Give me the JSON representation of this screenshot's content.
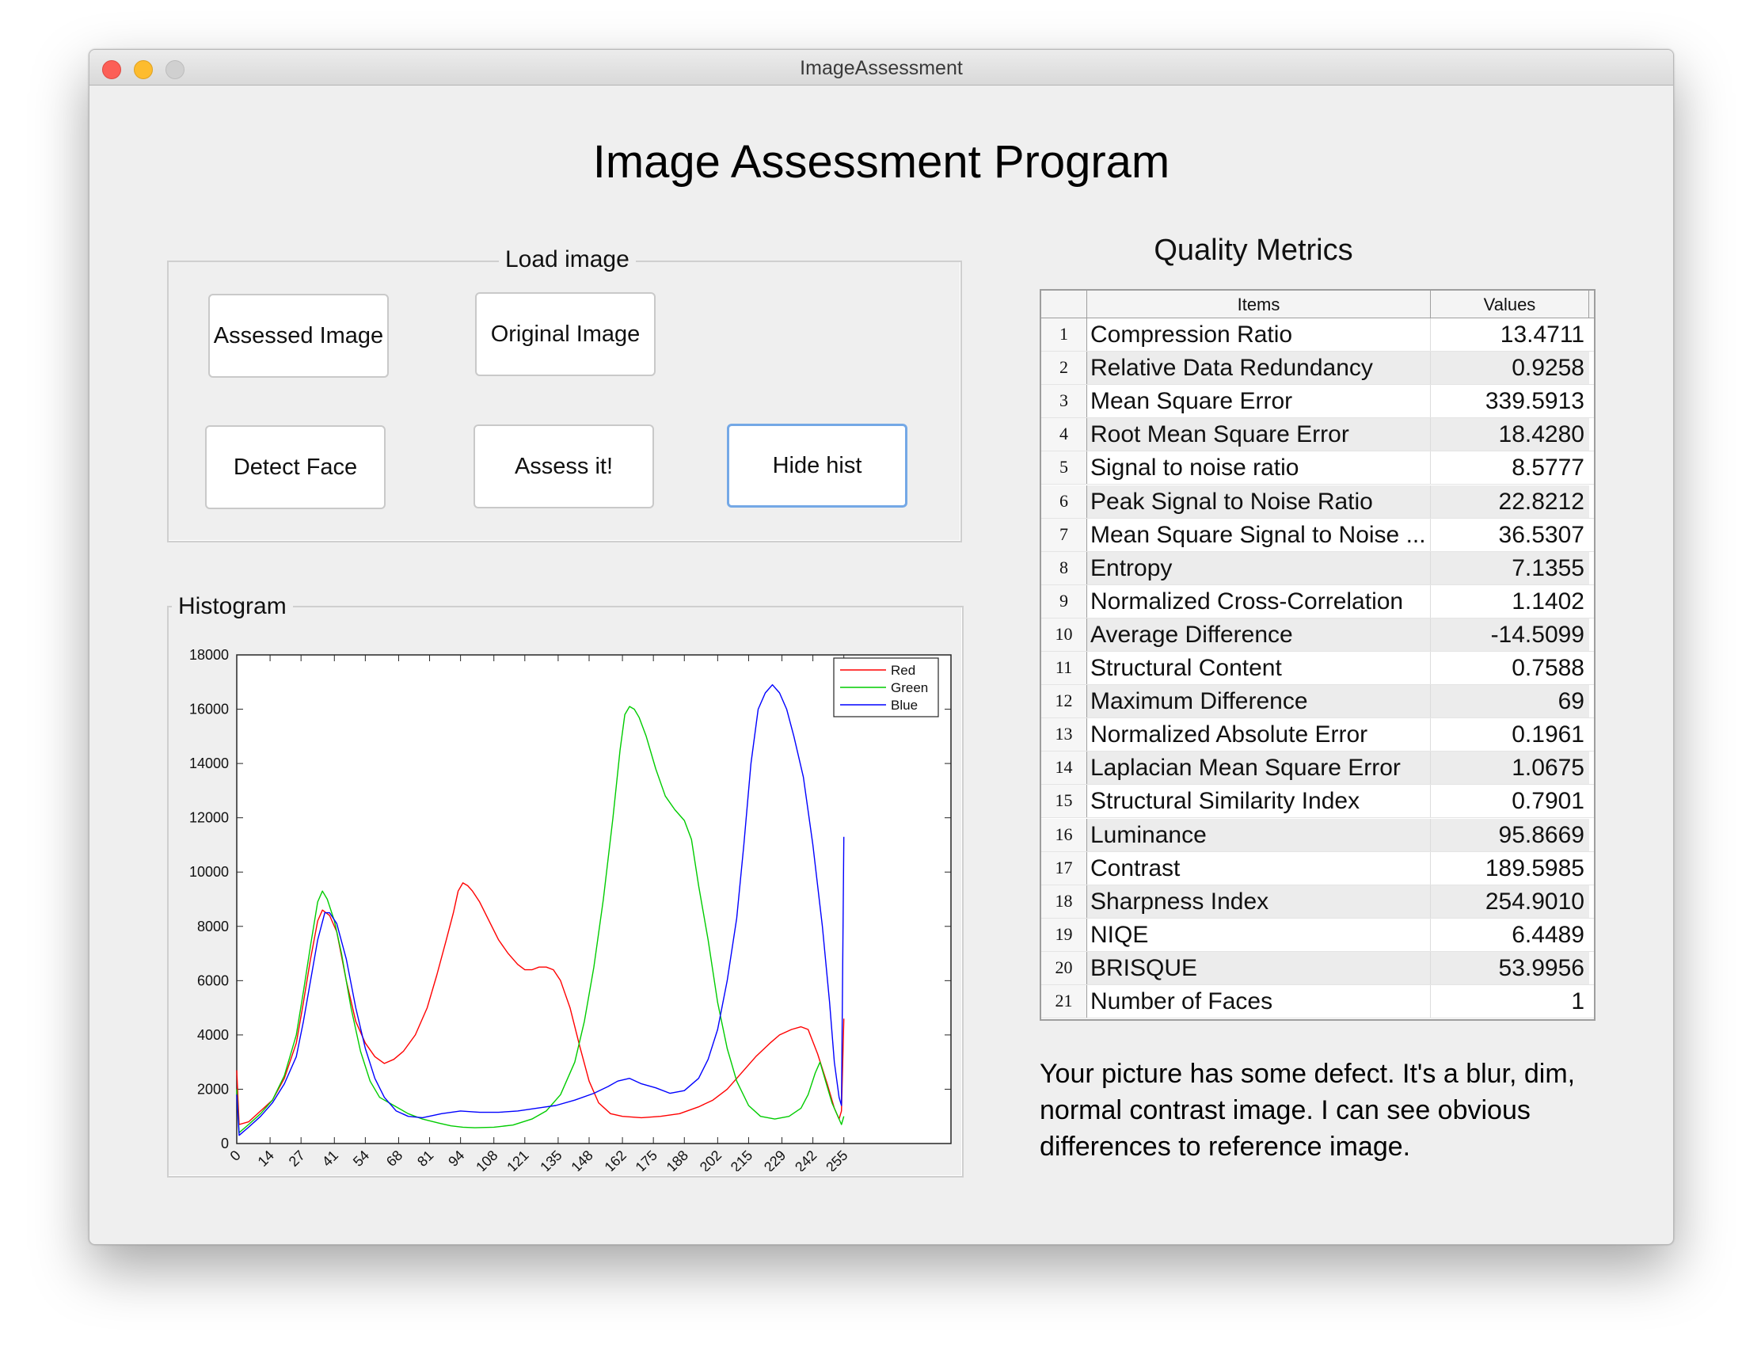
{
  "window": {
    "title": "ImageAssessment"
  },
  "app": {
    "title": "Image Assessment Program"
  },
  "load_panel": {
    "title": "Load image",
    "buttons": {
      "assessed_image": "Assessed Image",
      "original_image": "Original Image",
      "detect_face": "Detect Face",
      "assess": "Assess it!",
      "hide_hist": "Hide hist"
    }
  },
  "histogram_panel": {
    "title": "Histogram"
  },
  "metrics": {
    "title": "Quality Metrics",
    "columns": [
      "Items",
      "Values"
    ],
    "rows": [
      {
        "num": "1",
        "item": "Compression Ratio",
        "value": "13.4711"
      },
      {
        "num": "2",
        "item": "Relative Data Redundancy",
        "value": "0.9258"
      },
      {
        "num": "3",
        "item": "Mean Square Error",
        "value": "339.5913"
      },
      {
        "num": "4",
        "item": "Root Mean Square Error",
        "value": "18.4280"
      },
      {
        "num": "5",
        "item": "Signal to noise ratio",
        "value": "8.5777"
      },
      {
        "num": "6",
        "item": "Peak Signal to Noise Ratio",
        "value": "22.8212"
      },
      {
        "num": "7",
        "item": "Mean Square Signal to Noise ...",
        "value": "36.5307"
      },
      {
        "num": "8",
        "item": "Entropy",
        "value": "7.1355"
      },
      {
        "num": "9",
        "item": "Normalized Cross-Correlation",
        "value": "1.1402"
      },
      {
        "num": "10",
        "item": "Average Difference",
        "value": "-14.5099"
      },
      {
        "num": "11",
        "item": "Structural Content",
        "value": "0.7588"
      },
      {
        "num": "12",
        "item": "Maximum Difference",
        "value": "69"
      },
      {
        "num": "13",
        "item": "Normalized Absolute Error",
        "value": "0.1961"
      },
      {
        "num": "14",
        "item": "Laplacian Mean Square Error",
        "value": "1.0675"
      },
      {
        "num": "15",
        "item": "Structural Similarity Index",
        "value": "0.7901"
      },
      {
        "num": "16",
        "item": "Luminance",
        "value": "95.8669"
      },
      {
        "num": "17",
        "item": "Contrast",
        "value": "189.5985"
      },
      {
        "num": "18",
        "item": "Sharpness Index",
        "value": "254.9010"
      },
      {
        "num": "19",
        "item": "NIQE",
        "value": "6.4489"
      },
      {
        "num": "20",
        "item": "BRISQUE",
        "value": "53.9956"
      },
      {
        "num": "21",
        "item": "Number of Faces",
        "value": "1"
      }
    ]
  },
  "message": "Your picture has some defect. It's a blur, dim, normal contrast image. I can see obvious differences to reference image.",
  "chart_data": {
    "type": "line",
    "x_tick_labels": [
      "0",
      "14",
      "27",
      "41",
      "54",
      "68",
      "81",
      "94",
      "108",
      "121",
      "135",
      "148",
      "162",
      "175",
      "188",
      "202",
      "215",
      "229",
      "242",
      "255"
    ],
    "y_tick_labels": [
      "0",
      "2000",
      "4000",
      "6000",
      "8000",
      "10000",
      "12000",
      "14000",
      "16000",
      "18000"
    ],
    "xlim": [
      0,
      300
    ],
    "ylim": [
      0,
      18000
    ],
    "legend_position": "top-right",
    "series": [
      {
        "name": "Red",
        "color": "#ff0000",
        "points": [
          [
            0,
            2700
          ],
          [
            1,
            700
          ],
          [
            5,
            800
          ],
          [
            10,
            1200
          ],
          [
            15,
            1600
          ],
          [
            20,
            2400
          ],
          [
            25,
            3700
          ],
          [
            28,
            5200
          ],
          [
            31,
            6800
          ],
          [
            34,
            8200
          ],
          [
            36,
            8600
          ],
          [
            39,
            8400
          ],
          [
            42,
            7800
          ],
          [
            46,
            6000
          ],
          [
            50,
            4500
          ],
          [
            54,
            3700
          ],
          [
            58,
            3200
          ],
          [
            62,
            2950
          ],
          [
            66,
            3100
          ],
          [
            70,
            3400
          ],
          [
            75,
            4000
          ],
          [
            80,
            5000
          ],
          [
            84,
            6200
          ],
          [
            88,
            7500
          ],
          [
            91,
            8500
          ],
          [
            93,
            9300
          ],
          [
            95,
            9600
          ],
          [
            97,
            9500
          ],
          [
            99,
            9300
          ],
          [
            102,
            8900
          ],
          [
            106,
            8200
          ],
          [
            110,
            7500
          ],
          [
            114,
            7000
          ],
          [
            118,
            6600
          ],
          [
            121,
            6400
          ],
          [
            124,
            6400
          ],
          [
            127,
            6500
          ],
          [
            130,
            6500
          ],
          [
            133,
            6400
          ],
          [
            136,
            6000
          ],
          [
            140,
            5000
          ],
          [
            144,
            3600
          ],
          [
            148,
            2300
          ],
          [
            152,
            1500
          ],
          [
            157,
            1100
          ],
          [
            162,
            1000
          ],
          [
            170,
            950
          ],
          [
            178,
            1000
          ],
          [
            186,
            1100
          ],
          [
            194,
            1350
          ],
          [
            200,
            1600
          ],
          [
            206,
            2000
          ],
          [
            212,
            2600
          ],
          [
            218,
            3200
          ],
          [
            224,
            3700
          ],
          [
            228,
            4000
          ],
          [
            233,
            4200
          ],
          [
            237,
            4300
          ],
          [
            240,
            4200
          ],
          [
            244,
            3300
          ],
          [
            248,
            2200
          ],
          [
            251,
            1300
          ],
          [
            253,
            900
          ],
          [
            254,
            1200
          ],
          [
            255,
            4600
          ]
        ]
      },
      {
        "name": "Green",
        "color": "#00cc00",
        "points": [
          [
            0,
            2000
          ],
          [
            1,
            400
          ],
          [
            5,
            700
          ],
          [
            10,
            1100
          ],
          [
            15,
            1600
          ],
          [
            20,
            2500
          ],
          [
            25,
            4000
          ],
          [
            28,
            5600
          ],
          [
            31,
            7300
          ],
          [
            34,
            8900
          ],
          [
            36,
            9300
          ],
          [
            38,
            9000
          ],
          [
            41,
            8200
          ],
          [
            44,
            7000
          ],
          [
            48,
            5000
          ],
          [
            52,
            3400
          ],
          [
            56,
            2300
          ],
          [
            60,
            1700
          ],
          [
            66,
            1400
          ],
          [
            72,
            1100
          ],
          [
            78,
            900
          ],
          [
            85,
            750
          ],
          [
            90,
            650
          ],
          [
            95,
            600
          ],
          [
            100,
            580
          ],
          [
            108,
            600
          ],
          [
            116,
            680
          ],
          [
            124,
            900
          ],
          [
            130,
            1200
          ],
          [
            136,
            1800
          ],
          [
            142,
            3000
          ],
          [
            146,
            4500
          ],
          [
            150,
            6500
          ],
          [
            154,
            9000
          ],
          [
            158,
            12000
          ],
          [
            161,
            14500
          ],
          [
            163,
            15800
          ],
          [
            165,
            16100
          ],
          [
            167,
            16000
          ],
          [
            169,
            15700
          ],
          [
            172,
            15000
          ],
          [
            176,
            13800
          ],
          [
            180,
            12800
          ],
          [
            184,
            12300
          ],
          [
            188,
            11900
          ],
          [
            191,
            11200
          ],
          [
            194,
            9500
          ],
          [
            198,
            7500
          ],
          [
            202,
            5200
          ],
          [
            206,
            3500
          ],
          [
            210,
            2300
          ],
          [
            215,
            1400
          ],
          [
            220,
            1000
          ],
          [
            226,
            900
          ],
          [
            232,
            1000
          ],
          [
            237,
            1300
          ],
          [
            240,
            1800
          ],
          [
            243,
            2600
          ],
          [
            245,
            3000
          ],
          [
            247,
            2400
          ],
          [
            250,
            1500
          ],
          [
            253,
            900
          ],
          [
            254,
            700
          ],
          [
            255,
            1000
          ]
        ]
      },
      {
        "name": "Blue",
        "color": "#0000ff",
        "points": [
          [
            0,
            1800
          ],
          [
            1,
            300
          ],
          [
            5,
            600
          ],
          [
            10,
            1000
          ],
          [
            15,
            1500
          ],
          [
            20,
            2200
          ],
          [
            25,
            3200
          ],
          [
            28,
            4500
          ],
          [
            31,
            6000
          ],
          [
            34,
            7500
          ],
          [
            37,
            8500
          ],
          [
            39,
            8500
          ],
          [
            42,
            8100
          ],
          [
            46,
            6800
          ],
          [
            50,
            5000
          ],
          [
            54,
            3500
          ],
          [
            58,
            2400
          ],
          [
            62,
            1700
          ],
          [
            67,
            1200
          ],
          [
            72,
            1000
          ],
          [
            78,
            950
          ],
          [
            86,
            1100
          ],
          [
            94,
            1200
          ],
          [
            102,
            1150
          ],
          [
            110,
            1150
          ],
          [
            118,
            1200
          ],
          [
            126,
            1300
          ],
          [
            134,
            1400
          ],
          [
            142,
            1600
          ],
          [
            150,
            1850
          ],
          [
            156,
            2100
          ],
          [
            160,
            2300
          ],
          [
            165,
            2400
          ],
          [
            170,
            2200
          ],
          [
            176,
            2050
          ],
          [
            182,
            1850
          ],
          [
            188,
            1950
          ],
          [
            194,
            2400
          ],
          [
            198,
            3100
          ],
          [
            202,
            4200
          ],
          [
            206,
            6000
          ],
          [
            210,
            8300
          ],
          [
            213,
            11000
          ],
          [
            216,
            14000
          ],
          [
            219,
            16000
          ],
          [
            222,
            16600
          ],
          [
            225,
            16900
          ],
          [
            228,
            16600
          ],
          [
            231,
            16000
          ],
          [
            234,
            15000
          ],
          [
            238,
            13500
          ],
          [
            242,
            11000
          ],
          [
            246,
            8000
          ],
          [
            249,
            5200
          ],
          [
            251,
            3000
          ],
          [
            253,
            1700
          ],
          [
            254,
            1400
          ],
          [
            255,
            11300
          ]
        ]
      }
    ]
  }
}
